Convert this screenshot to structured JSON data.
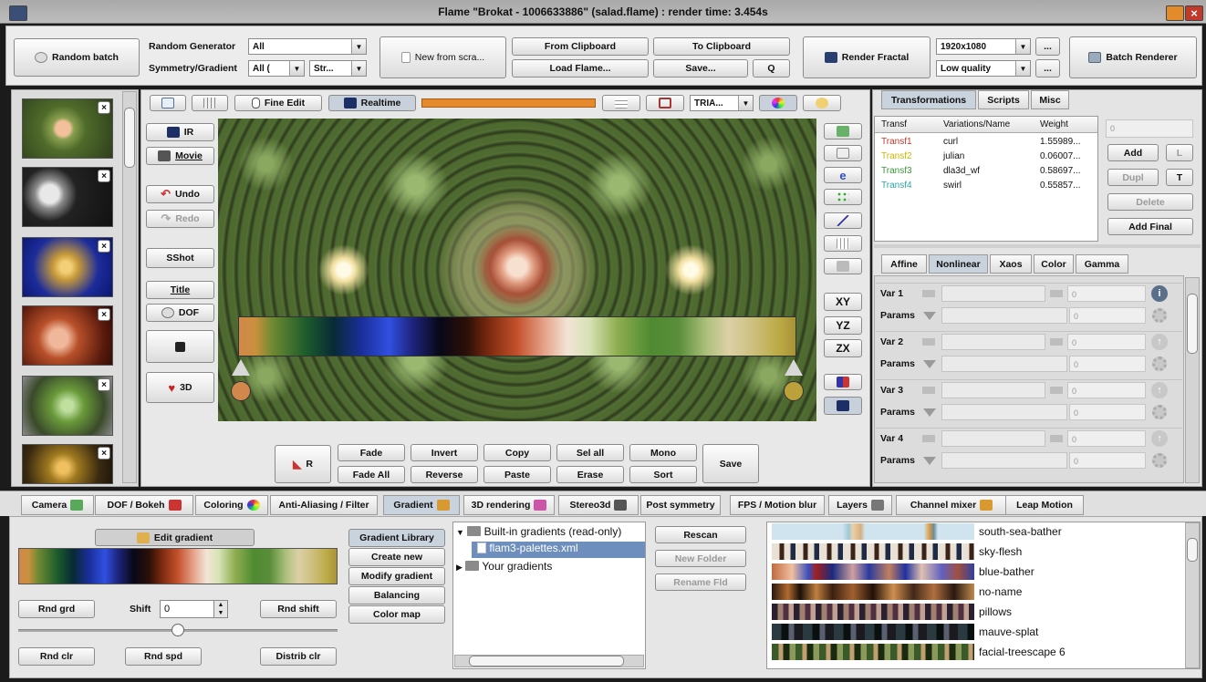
{
  "window": {
    "title": "Flame \"Brokat - 1006633886\" (salad.flame) : render time: 3.454s"
  },
  "toolbar": {
    "random_batch": "Random batch",
    "random_generator_label": "Random Generator",
    "random_generator_value": "All",
    "symmetry_label": "Symmetry/Gradient",
    "symmetry_value": "All (",
    "gradient_value": "Str...",
    "new_from_scratch": "New from scra...",
    "from_clipboard": "From Clipboard",
    "to_clipboard": "To Clipboard",
    "load_flame": "Load Flame...",
    "save": "Save...",
    "q_btn": "Q",
    "render_fractal": "Render Fractal",
    "resolution": "1920x1080",
    "quality": "Low quality",
    "more1": "...",
    "more2": "...",
    "batch_renderer": "Batch Renderer"
  },
  "preview_toolbar": {
    "fine_edit": "Fine Edit",
    "realtime": "Realtime",
    "tria": "TRIA..."
  },
  "left_tools": {
    "ir": "IR",
    "movie": "Movie",
    "undo": "Undo",
    "redo": "Redo",
    "sshot": "SShot",
    "title": "Title",
    "dof": "DOF",
    "three_d": "3D"
  },
  "right_tools": {
    "xy": "XY",
    "yz": "YZ",
    "zx": "ZX"
  },
  "gradient_bar": {
    "r": "R",
    "fade": "Fade",
    "fade_all": "Fade All",
    "invert": "Invert",
    "reverse": "Reverse",
    "copy": "Copy",
    "paste": "Paste",
    "sel_all": "Sel all",
    "erase": "Erase",
    "mono": "Mono",
    "sort": "Sort",
    "save": "Save"
  },
  "right_tabs": [
    "Transformations",
    "Scripts",
    "Misc"
  ],
  "transforms": {
    "headers": [
      "Transf",
      "Variations/Name",
      "Weight"
    ],
    "rows": [
      {
        "name": "Transf1",
        "var": "curl",
        "weight": "1.55989...",
        "color": "#c0392b"
      },
      {
        "name": "Transf2",
        "var": "julian",
        "weight": "0.06007...",
        "color": "#c8b800"
      },
      {
        "name": "Transf3",
        "var": "dla3d_wf",
        "weight": "0.58697...",
        "color": "#3a9a3a"
      },
      {
        "name": "Transf4",
        "var": "swirl",
        "weight": "0.55857...",
        "color": "#2aa7a7"
      }
    ],
    "spin_value": "0",
    "add": "Add",
    "l": "L",
    "dupl": "Dupl",
    "t": "T",
    "delete": "Delete",
    "add_final": "Add Final"
  },
  "sub_tabs": [
    "Affine",
    "Nonlinear",
    "Xaos",
    "Color",
    "Gamma"
  ],
  "vars": [
    {
      "label": "Var 1",
      "params": "Params",
      "value": "0",
      "pvalue": "0"
    },
    {
      "label": "Var 2",
      "params": "Params",
      "value": "0",
      "pvalue": "0"
    },
    {
      "label": "Var 3",
      "params": "Params",
      "value": "0",
      "pvalue": "0"
    },
    {
      "label": "Var 4",
      "params": "Params",
      "value": "0",
      "pvalue": "0"
    }
  ],
  "bottom_tabs": [
    "Camera",
    "DOF / Bokeh",
    "Coloring",
    "Anti-Aliasing / Filter",
    "Gradient",
    "3D rendering",
    "Stereo3d",
    "Post symmetry",
    "FPS / Motion blur",
    "Layers",
    "Channel mixer",
    "Leap Motion"
  ],
  "gradient_panel": {
    "edit_gradient": "Edit gradient",
    "rnd_grd": "Rnd grd",
    "shift_label": "Shift",
    "shift_value": "0",
    "rnd_shift": "Rnd shift",
    "shift_slider": 0.5,
    "rnd_clr": "Rnd clr",
    "rnd_spd": "Rnd spd",
    "distrib_clr": "Distrib clr"
  },
  "gradient_side": [
    "Gradient Library",
    "Create new",
    "Modify gradient",
    "Balancing",
    "Color map"
  ],
  "tree": {
    "builtin": "Built-in gradients (read-only)",
    "palettes": "flam3-palettes.xml",
    "yours": "Your gradients"
  },
  "lib_btns": {
    "rescan": "Rescan",
    "new_folder": "New Folder",
    "rename": "Rename Fld"
  },
  "palettes": [
    "south-sea-bather",
    "sky-flesh",
    "blue-bather",
    "no-name",
    "pillows",
    "mauve-splat",
    "facial-treescape 6"
  ]
}
